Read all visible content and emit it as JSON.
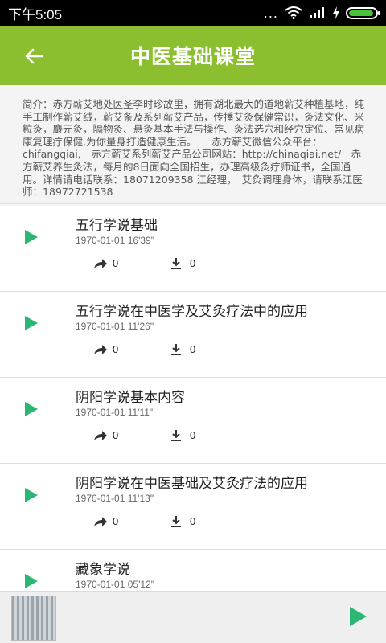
{
  "status_bar": {
    "time": "下午5:05",
    "dots": "..."
  },
  "header": {
    "title": "中医基础课堂"
  },
  "intro": {
    "text": "简介：赤方蕲艾地处医圣李时珍故里，拥有湖北最大的道地蕲艾种植基地，纯手工制作蕲艾绒，蕲艾条及系列蕲艾产品，传播艾灸保健常识，灸法文化、米粒灸，麝元灸，隔物灸、悬灸基本手法与操作、灸法选穴和经穴定位、常见病康复理疗保健,为你量身打造健康生活。　　赤方蕲艾微信公众平台：chifangqiai,　赤方蕲艾系列蕲艾产品公司网站：http://chinaqiai.net/　赤方蕲艾养生灸法，每月的8日面向全国招生，办理高级灸疗师证书，全国通用。详情请电话联系：18071209358 江经理，　艾灸调理身体，请联系江医师：18972721538"
  },
  "lessons": [
    {
      "title": "五行学说基础",
      "date": "1970-01-01  16'39\"",
      "shares": "0",
      "downloads": "0"
    },
    {
      "title": "五行学说在中医学及艾灸疗法中的应用",
      "date": "1970-01-01  11'26\"",
      "shares": "0",
      "downloads": "0"
    },
    {
      "title": "阴阳学说基本内容",
      "date": "1970-01-01  11'11\"",
      "shares": "0",
      "downloads": "0"
    },
    {
      "title": "阴阳学说在中医基础及艾灸疗法的应用",
      "date": "1970-01-01  11'13\"",
      "shares": "0",
      "downloads": "0"
    },
    {
      "title": "藏象学说",
      "date": "1970-01-01  05'12\"",
      "shares": "0",
      "downloads": "0"
    }
  ],
  "colors": {
    "header_bg": "#8cbf2f",
    "play_icon": "#2bb673"
  },
  "icons": {
    "back": "arrow-left-icon",
    "play": "play-icon",
    "share": "share-icon",
    "download": "download-icon"
  }
}
